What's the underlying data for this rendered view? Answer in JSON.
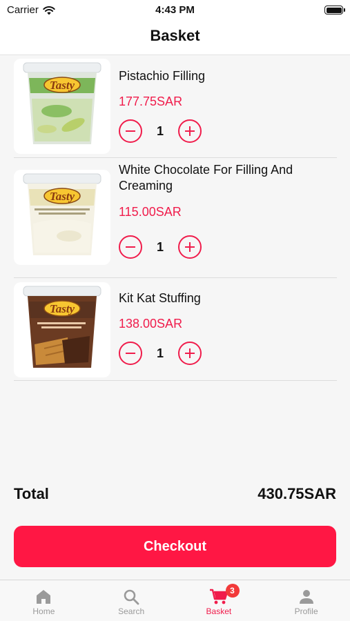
{
  "status_bar": {
    "carrier": "Carrier",
    "time": "4:43 PM"
  },
  "header": {
    "title": "Basket"
  },
  "basket": {
    "items": [
      {
        "name": "Pistachio Filling",
        "price": "177.75SAR",
        "quantity": "1",
        "brand": "Tasty",
        "tub_color": "#7db65a"
      },
      {
        "name": "White Chocolate For Filling And Creaming",
        "price": "115.00SAR",
        "quantity": "1",
        "brand": "Tasty",
        "tub_color": "#e9e2b8"
      },
      {
        "name": "Kit Kat Stuffing",
        "price": "138.00SAR",
        "quantity": "1",
        "brand": "Tasty",
        "tub_color": "#5a3320"
      }
    ]
  },
  "summary": {
    "total_label": "Total",
    "total_value": "430.75SAR",
    "checkout_label": "Checkout"
  },
  "tab_bar": {
    "tabs": [
      {
        "label": "Home",
        "icon": "home-icon"
      },
      {
        "label": "Search",
        "icon": "search-icon"
      },
      {
        "label": "Basket",
        "icon": "cart-icon",
        "badge": "3",
        "active": true
      },
      {
        "label": "Profile",
        "icon": "person-icon"
      }
    ]
  },
  "colors": {
    "accent": "#f01c4b",
    "checkout_bg": "#ff1744",
    "tab_inactive": "#999999"
  }
}
